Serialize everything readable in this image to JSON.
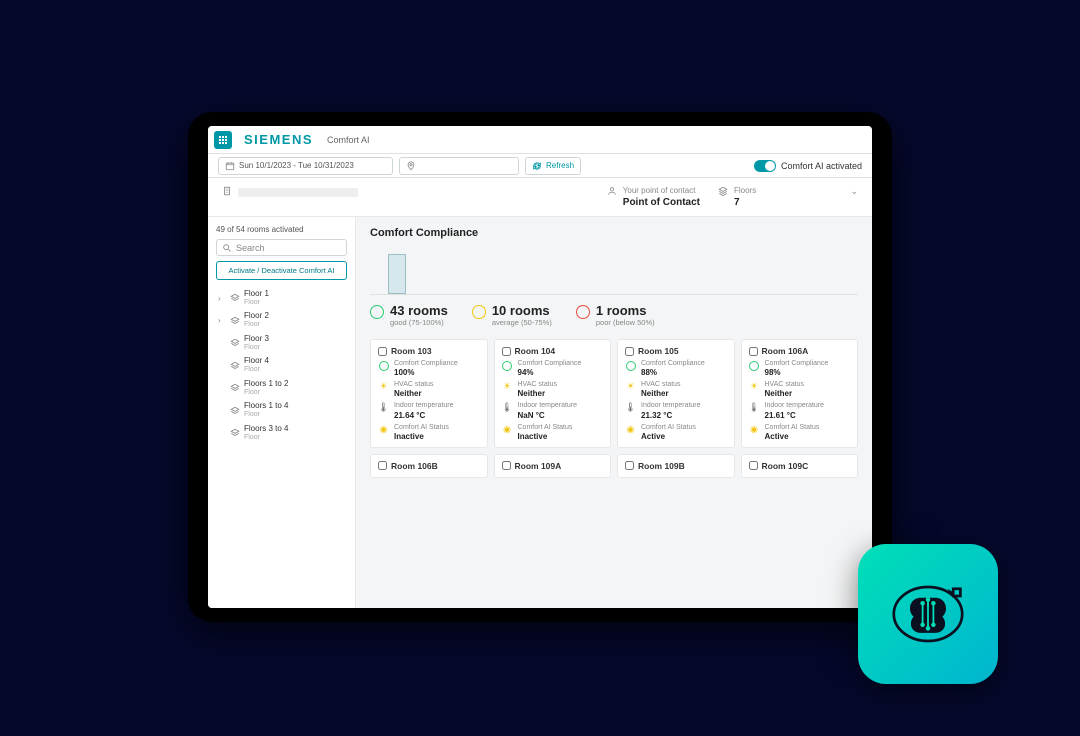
{
  "header": {
    "brand": "SIEMENS",
    "app": "Comfort AI"
  },
  "filters": {
    "date_range": "Sun 10/1/2023 - Tue 10/31/2023",
    "refresh": "Refresh",
    "toggle_label": "Comfort AI activated"
  },
  "info": {
    "contact_label": "Your point of contact",
    "contact_value": "Point of Contact",
    "floors_label": "Floors",
    "floors_value": "7"
  },
  "sidebar": {
    "count": "49 of 54 rooms activated",
    "search_placeholder": "Search",
    "toggle_button": "Activate / Deactivate Comfort AI",
    "floors": [
      {
        "name": "Floor 1",
        "sub": "Floor",
        "expandable": true
      },
      {
        "name": "Floor 2",
        "sub": "Floor",
        "expandable": true
      },
      {
        "name": "Floor 3",
        "sub": "Floor",
        "expandable": false
      },
      {
        "name": "Floor 4",
        "sub": "Floor",
        "expandable": false
      },
      {
        "name": "Floors 1 to 2",
        "sub": "Floor",
        "expandable": false
      },
      {
        "name": "Floors 1 to 4",
        "sub": "Floor",
        "expandable": false
      },
      {
        "name": "Floors 3 to 4",
        "sub": "Floor",
        "expandable": false
      }
    ]
  },
  "main": {
    "title": "Comfort Compliance",
    "stats": [
      {
        "count": "43 rooms",
        "label": "good (75-100%)",
        "mood": "good"
      },
      {
        "count": "10 rooms",
        "label": "average (50-75%)",
        "mood": "avg"
      },
      {
        "count": "1 rooms",
        "label": "poor (below 50%)",
        "mood": "poor"
      }
    ],
    "metric_labels": {
      "compliance": "Comfort Compliance",
      "hvac": "HVAC status",
      "temp": "Indoor temperature",
      "ai": "Comfort AI Status"
    },
    "rooms": [
      {
        "name": "Room 103",
        "compliance": "100%",
        "hvac": "Neither",
        "temp": "21.64 °C",
        "ai": "Inactive"
      },
      {
        "name": "Room 104",
        "compliance": "94%",
        "hvac": "Neither",
        "temp": "NaN °C",
        "ai": "Inactive"
      },
      {
        "name": "Room 105",
        "compliance": "88%",
        "hvac": "Neither",
        "temp": "21.32 °C",
        "ai": "Active"
      },
      {
        "name": "Room 106A",
        "compliance": "98%",
        "hvac": "Neither",
        "temp": "21.61 °C",
        "ai": "Active"
      },
      {
        "name": "Room 106B"
      },
      {
        "name": "Room 109A"
      },
      {
        "name": "Room 109B"
      },
      {
        "name": "Room 109C"
      }
    ]
  }
}
